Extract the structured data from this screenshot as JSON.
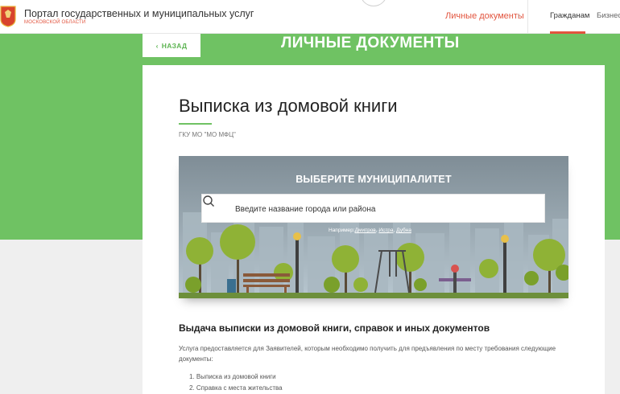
{
  "header": {
    "portal_title": "Портал государственных и муниципальных услуг",
    "portal_subtitle": "МОСКОВСКОЙ ОБЛАСТИ",
    "personal_docs_link": "Личные документы",
    "tabs": [
      {
        "label": "Гражданам",
        "active": true
      },
      {
        "label": "Бизнесу",
        "active": false
      }
    ]
  },
  "hero": {
    "back_label": "НАЗАД",
    "page_heading": "ЛИЧНЫЕ ДОКУМЕНТЫ"
  },
  "service": {
    "title": "Выписка из домовой книги",
    "org": "ГКУ МО \"МО МФЦ\""
  },
  "municipality": {
    "title": "ВЫБЕРИТЕ МУНИЦИПАЛИТЕТ",
    "search_placeholder": "Введите название города или района",
    "examples_prefix": "Например:",
    "examples": [
      "Дмитров",
      "Истра",
      "Дубна"
    ]
  },
  "details": {
    "heading": "Выдача выписки из домовой книги, справок и иных документов",
    "description": "Услуга предоставляется для Заявителей, которым необходимо получить для предъявления по месту требования следующие документы:",
    "items": [
      "1. Выписка из домовой книги",
      "2. Справка с места жительства"
    ]
  },
  "colors": {
    "accent_green": "#6fc263",
    "accent_red": "#e2543e"
  }
}
